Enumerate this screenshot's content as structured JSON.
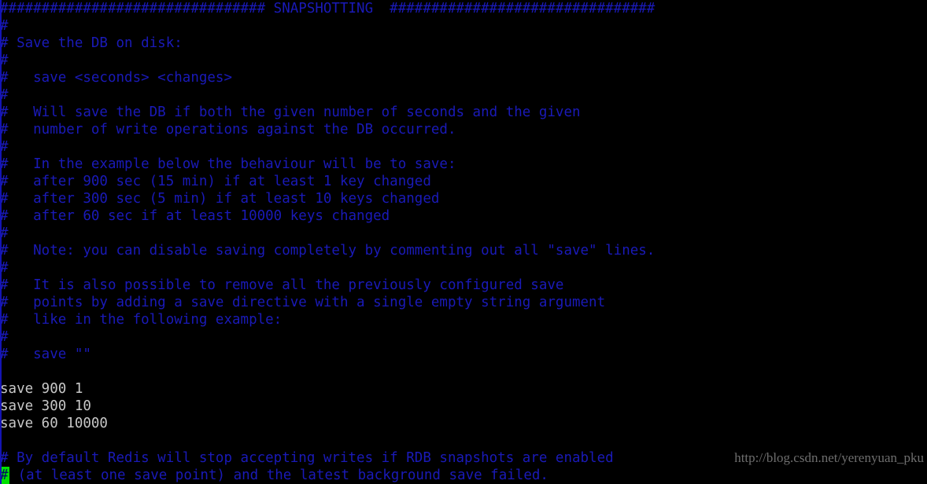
{
  "terminal": {
    "app": "text-editor-terminal",
    "file": "redis.conf",
    "columns": 97,
    "rows": 28,
    "colors": {
      "background": "#000000",
      "comment_blue": "#1a1ab8",
      "code_gray": "#c8c8c8",
      "cursor_green": "#00e000",
      "cursor_text": "#001060",
      "left_edge_strip": "#1414b4",
      "watermark_gray": "#6e6e6e"
    }
  },
  "cursor": {
    "row": 27,
    "column": 0,
    "character": "#"
  },
  "watermark": {
    "text": "http://blog.csdn.net/yerenyuan_pku"
  },
  "lines": [
    {
      "id": 0,
      "type": "comment",
      "text": "################################ SNAPSHOTTING  ################################"
    },
    {
      "id": 1,
      "type": "comment",
      "text": "#"
    },
    {
      "id": 2,
      "type": "comment",
      "text": "# Save the DB on disk:"
    },
    {
      "id": 3,
      "type": "comment",
      "text": "#"
    },
    {
      "id": 4,
      "type": "comment",
      "text": "#   save <seconds> <changes>"
    },
    {
      "id": 5,
      "type": "comment",
      "text": "#"
    },
    {
      "id": 6,
      "type": "comment",
      "text": "#   Will save the DB if both the given number of seconds and the given"
    },
    {
      "id": 7,
      "type": "comment",
      "text": "#   number of write operations against the DB occurred."
    },
    {
      "id": 8,
      "type": "comment",
      "text": "#"
    },
    {
      "id": 9,
      "type": "comment",
      "text": "#   In the example below the behaviour will be to save:"
    },
    {
      "id": 10,
      "type": "comment",
      "text": "#   after 900 sec (15 min) if at least 1 key changed"
    },
    {
      "id": 11,
      "type": "comment",
      "text": "#   after 300 sec (5 min) if at least 10 keys changed"
    },
    {
      "id": 12,
      "type": "comment",
      "text": "#   after 60 sec if at least 10000 keys changed"
    },
    {
      "id": 13,
      "type": "comment",
      "text": "#"
    },
    {
      "id": 14,
      "type": "comment",
      "text": "#   Note: you can disable saving completely by commenting out all \"save\" lines."
    },
    {
      "id": 15,
      "type": "comment",
      "text": "#"
    },
    {
      "id": 16,
      "type": "comment",
      "text": "#   It is also possible to remove all the previously configured save"
    },
    {
      "id": 17,
      "type": "comment",
      "text": "#   points by adding a save directive with a single empty string argument"
    },
    {
      "id": 18,
      "type": "comment",
      "text": "#   like in the following example:"
    },
    {
      "id": 19,
      "type": "comment",
      "text": "#"
    },
    {
      "id": 20,
      "type": "comment",
      "text": "#   save \"\""
    },
    {
      "id": 21,
      "type": "blank",
      "text": ""
    },
    {
      "id": 22,
      "type": "code",
      "text": "save 900 1"
    },
    {
      "id": 23,
      "type": "code",
      "text": "save 300 10"
    },
    {
      "id": 24,
      "type": "code",
      "text": "save 60 10000"
    },
    {
      "id": 25,
      "type": "blank",
      "text": ""
    },
    {
      "id": 26,
      "type": "comment",
      "text": "# By default Redis will stop accepting writes if RDB snapshots are enabled"
    },
    {
      "id": 27,
      "type": "comment",
      "text": "# (at least one save point) and the latest background save failed.",
      "has_cursor": true
    }
  ]
}
